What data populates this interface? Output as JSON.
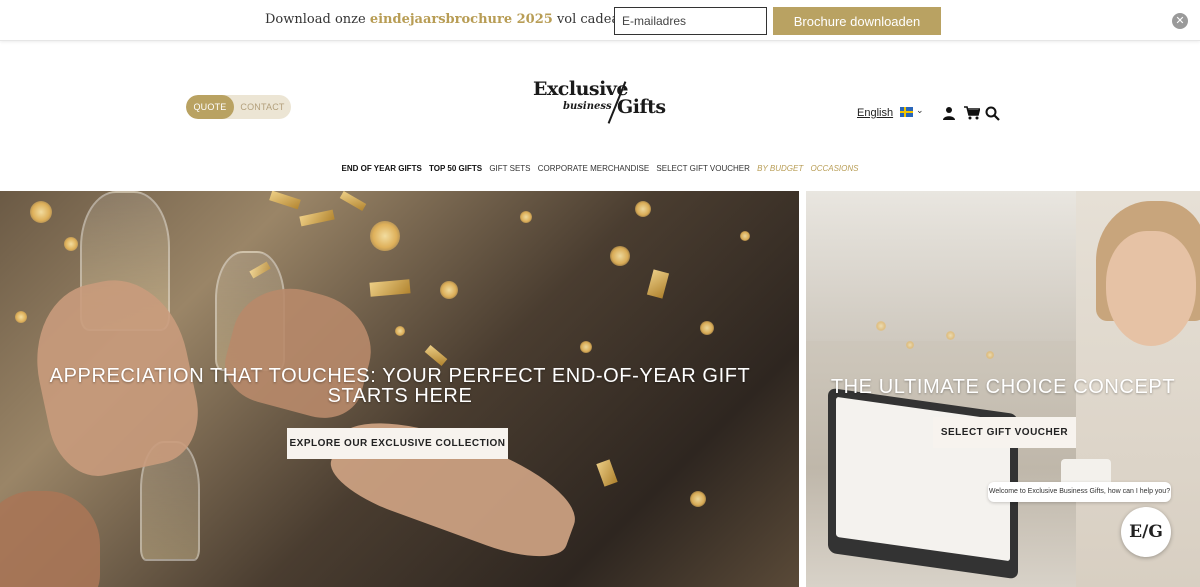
{
  "promo": {
    "text_before": "Download onze ",
    "highlight": "eindejaarsbrochure 2025",
    "text_after": " vol cadeau-inspiratie",
    "email_placeholder": "E-mailadres",
    "button_label": "Brochure downloaden",
    "close_glyph": "✕"
  },
  "header": {
    "quote_label": "QUOTE",
    "contact_label": "CONTACT",
    "logo": {
      "line1": "Exclusive",
      "line2": "business",
      "line3": "Gifts"
    },
    "language": "English",
    "flag": "sweden-flag",
    "chevron": "⌄",
    "icons": [
      "user-icon",
      "cart-icon",
      "search-icon"
    ]
  },
  "nav": {
    "items": [
      {
        "label": "END OF YEAR GIFTS",
        "style": "bold"
      },
      {
        "label": "TOP 50 GIFTS",
        "style": "bold"
      },
      {
        "label": "GIFT SETS",
        "style": "normal"
      },
      {
        "label": "CORPORATE MERCHANDISE",
        "style": "normal"
      },
      {
        "label": "SELECT GIFT VOUCHER",
        "style": "normal"
      },
      {
        "label": "BY BUDGET",
        "style": "gold"
      },
      {
        "label": "OCCASIONS",
        "style": "gold"
      }
    ]
  },
  "hero_left": {
    "title": "APPRECIATION THAT TOUCHES: YOUR PERFECT END-OF-YEAR GIFT STARTS HERE",
    "button_label": "EXPLORE OUR EXCLUSIVE COLLECTION"
  },
  "hero_right": {
    "title": "THE ULTIMATE CHOICE CONCEPT",
    "button_label": "SELECT GIFT VOUCHER"
  },
  "chat": {
    "bubble_text": "Welcome to Exclusive Business Gifts, how can I help you?",
    "logo_text": "E/G"
  },
  "colors": {
    "gold": "#b9a262",
    "gold_text": "#b89d55",
    "pill_bg": "#ece5d4"
  }
}
